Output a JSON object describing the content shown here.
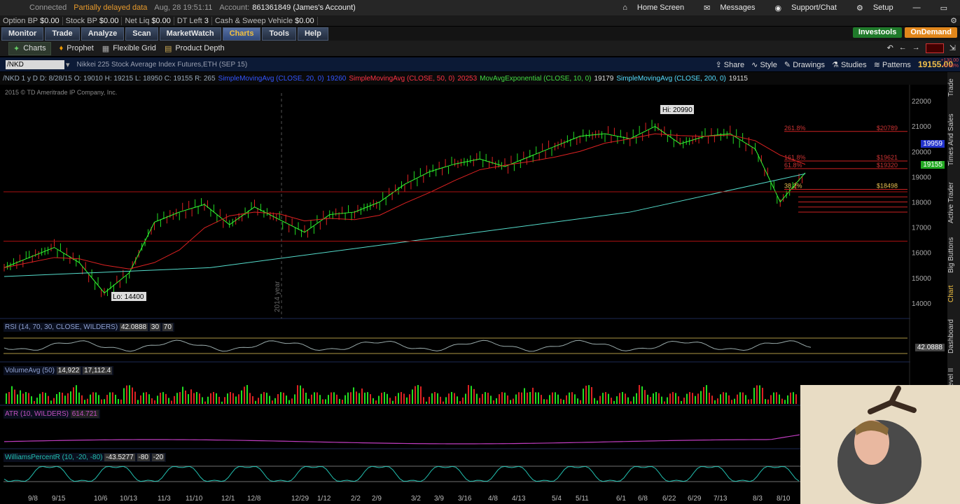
{
  "topbar": {
    "connected": "Connected",
    "delayed": "Partially delayed data",
    "datetime": "Aug, 28  19:51:11",
    "account_label": "Account:",
    "account_value": "861361849 (James's Account)",
    "links": [
      "Home Screen",
      "Messages",
      "Support/Chat",
      "Setup"
    ]
  },
  "account_bar": {
    "cells": [
      {
        "label": "Option BP",
        "value": "$0.00"
      },
      {
        "label": "Stock BP",
        "value": "$0.00"
      },
      {
        "label": "Net Liq",
        "value": "$0.00"
      },
      {
        "label": "DT Left",
        "value": "3"
      },
      {
        "label": "Cash & Sweep Vehicle",
        "value": "$0.00"
      }
    ]
  },
  "nav": {
    "tabs": [
      "Monitor",
      "Trade",
      "Analyze",
      "Scan",
      "MarketWatch",
      "Charts",
      "Tools",
      "Help"
    ],
    "active": "Charts",
    "investools": "Investools",
    "ondemand": "OnDemand"
  },
  "subtabs": [
    "Charts",
    "Prophet",
    "Flexible Grid",
    "Product Depth"
  ],
  "chart_header": {
    "symbol": "/NKD",
    "description": "Nikkei 225 Stock Average Index Futures,ETH (SEP 15)",
    "tools": [
      "Share",
      "Style",
      "Drawings",
      "Studies",
      "Patterns"
    ],
    "last_price": "19155.00",
    "change_top": "+130.00",
    "change_bottom": "+0.68%"
  },
  "study_line": {
    "ohlc": "/NKD 1 y D   D: 8/28/15   O: 19010   H: 19215   L: 18950   C: 19155   R: 265",
    "studies": [
      {
        "text": "SimpleMovingAvg (CLOSE, 20, 0)",
        "color": "#3355ff"
      },
      {
        "text": "19260",
        "color": "#3355ff"
      },
      {
        "text": "SimpleMovingAvg (CLOSE, 50, 0)",
        "color": "#ff3344"
      },
      {
        "text": "20253",
        "color": "#ff3344"
      },
      {
        "text": "MovAvgExponential (CLOSE, 10, 0)",
        "color": "#44dd44"
      },
      {
        "text": "19179",
        "color": "#dddddd"
      },
      {
        "text": "SimpleMovingAvg (CLOSE, 200, 0)",
        "color": "#55ddff"
      },
      {
        "text": "19115",
        "color": "#dddddd"
      }
    ]
  },
  "copyright": "2015 © TD Ameritrade IP Company, Inc.",
  "annotations": {
    "hi": "Hi: 20990",
    "lo": "Lo: 14400",
    "year": "2014 year"
  },
  "fib_labels": [
    {
      "pct": "261.8%",
      "price": "$20789"
    },
    {
      "pct": "161.8%",
      "price": "$19621"
    },
    {
      "pct": "61.8%",
      "price": "$19320"
    },
    {
      "pct": "38.2%",
      "price": "$18498"
    }
  ],
  "price_badges": [
    "19959",
    "19155"
  ],
  "panels": {
    "rsi": {
      "label": "RSI (14, 70, 30, CLOSE, WILDERS)",
      "value": "42.0888",
      "levels": [
        "30",
        "70"
      ],
      "badge": "42.0888"
    },
    "volume": {
      "label": "VolumeAvg (50)",
      "value": "14,922",
      "avg": "17,112.4"
    },
    "atr": {
      "label": "ATR (10, WILDERS)",
      "value": "614.721"
    },
    "williams": {
      "label": "WilliamsPercentR (10, -20, -80)",
      "value": "-43.5277",
      "levels": [
        "-80",
        "-20"
      ]
    }
  },
  "side_tabs": [
    "Trade",
    "Times And Sales",
    "Active Trader",
    "Big Buttons",
    "Chart",
    "Dashboard",
    "Level II"
  ],
  "chart_data": {
    "type": "line",
    "title": "/NKD 1 y D",
    "y_ticks": [
      "22000",
      "21000",
      "20000",
      "19000",
      "18000",
      "17000",
      "16000",
      "15000",
      "14000"
    ],
    "ylim": [
      13500,
      22500
    ],
    "x_ticks": [
      "9/8",
      "9/15",
      "10/6",
      "10/13",
      "11/3",
      "11/10",
      "12/1",
      "12/8",
      "12/29",
      "1/12",
      "2/2",
      "2/9",
      "3/2",
      "3/9",
      "3/16",
      "4/8",
      "4/13",
      "5/4",
      "5/11",
      "6/1",
      "6/8",
      "6/22",
      "6/29",
      "7/13",
      "8/3",
      "8/10"
    ],
    "series": [
      {
        "values": [
          15400,
          15800,
          16200,
          15600,
          14400,
          15200,
          17200,
          17600,
          17900,
          17100,
          17800,
          17300,
          16800,
          17500,
          17600,
          18000,
          18700,
          19200,
          19500,
          19700,
          19400,
          19800,
          20200,
          20600,
          20700,
          20500,
          20990,
          20300,
          20600,
          20700,
          20100,
          18000,
          19155
        ]
      }
    ],
    "colors": {
      "price": "#22dd22",
      "sma50": "#dd2222",
      "sma200": "#55ddcc",
      "ema10": "#33ff33"
    }
  }
}
